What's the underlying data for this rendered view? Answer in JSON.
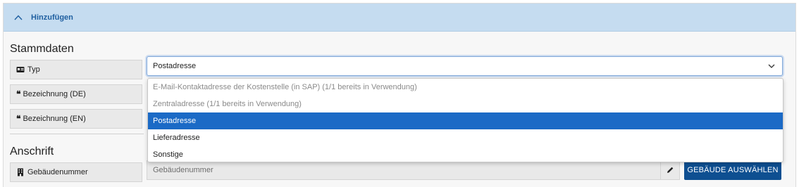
{
  "header": {
    "label": "Hinzufügen",
    "icon": "chevron-up-icon"
  },
  "stammdaten": {
    "title": "Stammdaten",
    "typ_label": "Typ",
    "typ_value": "Postadresse",
    "bez_de_label": "Bezeichnung (DE)",
    "bez_en_label": "Bezeichnung (EN)"
  },
  "dropdown": {
    "options": [
      {
        "label": "E-Mail-Kontaktadresse der Kostenstelle (in SAP) (1/1 bereits in Verwendung)",
        "state": "disabled"
      },
      {
        "label": "Zentraladresse (1/1 bereits in Verwendung)",
        "state": "disabled"
      },
      {
        "label": "Postadresse",
        "state": "selected"
      },
      {
        "label": "Lieferadresse",
        "state": "normal"
      },
      {
        "label": "Sonstige",
        "state": "normal"
      }
    ]
  },
  "anschrift": {
    "title": "Anschrift",
    "gebaeude_label": "Gebäudenummer",
    "gebaeude_placeholder": "Gebäudenummer",
    "select_button": "GEBÄUDE AUSWÄHLEN"
  },
  "colors": {
    "header_bg": "#c5dcf0",
    "header_text": "#1f5fa0",
    "selected_bg": "#1b6ac6",
    "button_bg": "#0e4f91"
  }
}
